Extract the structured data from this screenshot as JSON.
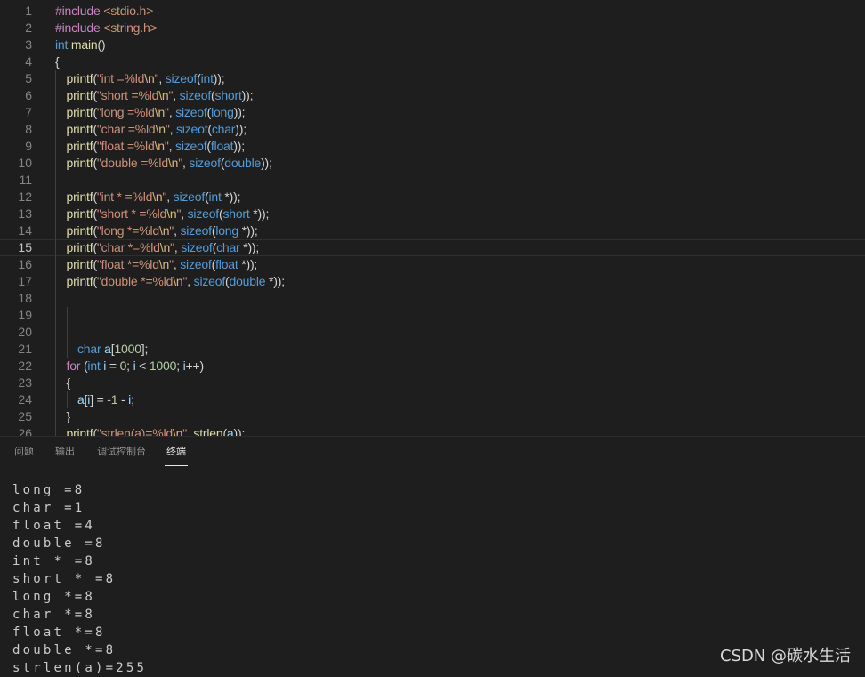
{
  "editor": {
    "active_line": 15,
    "lines": [
      {
        "n": "1",
        "tokens": [
          [
            "#include ",
            "kw"
          ],
          [
            "<stdio.h>",
            "str"
          ]
        ]
      },
      {
        "n": "2",
        "tokens": [
          [
            "#include ",
            "kw"
          ],
          [
            "<string.h>",
            "str"
          ]
        ]
      },
      {
        "n": "3",
        "tokens": [
          [
            "int",
            "type"
          ],
          [
            " ",
            "p"
          ],
          [
            "main",
            "fn"
          ],
          [
            "()",
            "p"
          ]
        ]
      },
      {
        "n": "4",
        "tokens": [
          [
            "{",
            "p"
          ]
        ]
      },
      {
        "n": "5",
        "indent": 1,
        "tokens": [
          [
            "printf",
            "fn"
          ],
          [
            "(",
            "p"
          ],
          [
            "\"int =%ld",
            "str"
          ],
          [
            "\\n",
            "esc"
          ],
          [
            "\"",
            "str"
          ],
          [
            ", ",
            "p"
          ],
          [
            "sizeof",
            "type"
          ],
          [
            "(",
            "p"
          ],
          [
            "int",
            "type"
          ],
          [
            "));",
            "p"
          ]
        ]
      },
      {
        "n": "6",
        "indent": 1,
        "tokens": [
          [
            "printf",
            "fn"
          ],
          [
            "(",
            "p"
          ],
          [
            "\"short =%ld",
            "str"
          ],
          [
            "\\n",
            "esc"
          ],
          [
            "\"",
            "str"
          ],
          [
            ", ",
            "p"
          ],
          [
            "sizeof",
            "type"
          ],
          [
            "(",
            "p"
          ],
          [
            "short",
            "type"
          ],
          [
            "));",
            "p"
          ]
        ]
      },
      {
        "n": "7",
        "indent": 1,
        "tokens": [
          [
            "printf",
            "fn"
          ],
          [
            "(",
            "p"
          ],
          [
            "\"long =%ld",
            "str"
          ],
          [
            "\\n",
            "esc"
          ],
          [
            "\"",
            "str"
          ],
          [
            ", ",
            "p"
          ],
          [
            "sizeof",
            "type"
          ],
          [
            "(",
            "p"
          ],
          [
            "long",
            "type"
          ],
          [
            "));",
            "p"
          ]
        ]
      },
      {
        "n": "8",
        "indent": 1,
        "tokens": [
          [
            "printf",
            "fn"
          ],
          [
            "(",
            "p"
          ],
          [
            "\"char =%ld",
            "str"
          ],
          [
            "\\n",
            "esc"
          ],
          [
            "\"",
            "str"
          ],
          [
            ", ",
            "p"
          ],
          [
            "sizeof",
            "type"
          ],
          [
            "(",
            "p"
          ],
          [
            "char",
            "type"
          ],
          [
            "));",
            "p"
          ]
        ]
      },
      {
        "n": "9",
        "indent": 1,
        "tokens": [
          [
            "printf",
            "fn"
          ],
          [
            "(",
            "p"
          ],
          [
            "\"float =%ld",
            "str"
          ],
          [
            "\\n",
            "esc"
          ],
          [
            "\"",
            "str"
          ],
          [
            ", ",
            "p"
          ],
          [
            "sizeof",
            "type"
          ],
          [
            "(",
            "p"
          ],
          [
            "float",
            "type"
          ],
          [
            "));",
            "p"
          ]
        ]
      },
      {
        "n": "10",
        "indent": 1,
        "tokens": [
          [
            "printf",
            "fn"
          ],
          [
            "(",
            "p"
          ],
          [
            "\"double =%ld",
            "str"
          ],
          [
            "\\n",
            "esc"
          ],
          [
            "\"",
            "str"
          ],
          [
            ", ",
            "p"
          ],
          [
            "sizeof",
            "type"
          ],
          [
            "(",
            "p"
          ],
          [
            "double",
            "type"
          ],
          [
            "));",
            "p"
          ]
        ]
      },
      {
        "n": "11",
        "indent": 1,
        "tokens": []
      },
      {
        "n": "12",
        "indent": 1,
        "tokens": [
          [
            "printf",
            "fn"
          ],
          [
            "(",
            "p"
          ],
          [
            "\"int * =%ld",
            "str"
          ],
          [
            "\\n",
            "esc"
          ],
          [
            "\"",
            "str"
          ],
          [
            ", ",
            "p"
          ],
          [
            "sizeof",
            "type"
          ],
          [
            "(",
            "p"
          ],
          [
            "int",
            "type"
          ],
          [
            " *));",
            "p"
          ]
        ]
      },
      {
        "n": "13",
        "indent": 1,
        "tokens": [
          [
            "printf",
            "fn"
          ],
          [
            "(",
            "p"
          ],
          [
            "\"short * =%ld",
            "str"
          ],
          [
            "\\n",
            "esc"
          ],
          [
            "\"",
            "str"
          ],
          [
            ", ",
            "p"
          ],
          [
            "sizeof",
            "type"
          ],
          [
            "(",
            "p"
          ],
          [
            "short",
            "type"
          ],
          [
            " *));",
            "p"
          ]
        ]
      },
      {
        "n": "14",
        "indent": 1,
        "tokens": [
          [
            "printf",
            "fn"
          ],
          [
            "(",
            "p"
          ],
          [
            "\"long *=%ld",
            "str"
          ],
          [
            "\\n",
            "esc"
          ],
          [
            "\"",
            "str"
          ],
          [
            ", ",
            "p"
          ],
          [
            "sizeof",
            "type"
          ],
          [
            "(",
            "p"
          ],
          [
            "long",
            "type"
          ],
          [
            " *));",
            "p"
          ]
        ]
      },
      {
        "n": "15",
        "indent": 1,
        "tokens": [
          [
            "printf",
            "fn"
          ],
          [
            "(",
            "p"
          ],
          [
            "\"char *=%ld",
            "str"
          ],
          [
            "\\n",
            "esc"
          ],
          [
            "\"",
            "str"
          ],
          [
            ", ",
            "p"
          ],
          [
            "sizeof",
            "type"
          ],
          [
            "(",
            "p"
          ],
          [
            "char",
            "type"
          ],
          [
            " *));",
            "p"
          ]
        ]
      },
      {
        "n": "16",
        "indent": 1,
        "tokens": [
          [
            "printf",
            "fn"
          ],
          [
            "(",
            "p"
          ],
          [
            "\"float *=%ld",
            "str"
          ],
          [
            "\\n",
            "esc"
          ],
          [
            "\"",
            "str"
          ],
          [
            ", ",
            "p"
          ],
          [
            "sizeof",
            "type"
          ],
          [
            "(",
            "p"
          ],
          [
            "float",
            "type"
          ],
          [
            " *));",
            "p"
          ]
        ]
      },
      {
        "n": "17",
        "indent": 1,
        "tokens": [
          [
            "printf",
            "fn"
          ],
          [
            "(",
            "p"
          ],
          [
            "\"double *=%ld",
            "str"
          ],
          [
            "\\n",
            "esc"
          ],
          [
            "\"",
            "str"
          ],
          [
            ", ",
            "p"
          ],
          [
            "sizeof",
            "type"
          ],
          [
            "(",
            "p"
          ],
          [
            "double",
            "type"
          ],
          [
            " *));",
            "p"
          ]
        ]
      },
      {
        "n": "18",
        "indent": 1,
        "tokens": []
      },
      {
        "n": "19",
        "indent": 2,
        "tokens": []
      },
      {
        "n": "20",
        "indent": 2,
        "tokens": []
      },
      {
        "n": "21",
        "indent": 2,
        "tokens": [
          [
            "char",
            "type"
          ],
          [
            " ",
            "p"
          ],
          [
            "a",
            "var"
          ],
          [
            "[",
            "p"
          ],
          [
            "1000",
            "num"
          ],
          [
            "];",
            "p"
          ]
        ]
      },
      {
        "n": "22",
        "indent": 1,
        "tokens": [
          [
            "for",
            "kw"
          ],
          [
            " (",
            "p"
          ],
          [
            "int",
            "type"
          ],
          [
            " ",
            "p"
          ],
          [
            "i",
            "var"
          ],
          [
            " = ",
            "p"
          ],
          [
            "0",
            "num"
          ],
          [
            "; ",
            "p"
          ],
          [
            "i",
            "var"
          ],
          [
            " < ",
            "p"
          ],
          [
            "1000",
            "num"
          ],
          [
            "; ",
            "p"
          ],
          [
            "i",
            "var"
          ],
          [
            "++)",
            "p"
          ]
        ]
      },
      {
        "n": "23",
        "indent": 1,
        "tokens": [
          [
            "{",
            "p"
          ]
        ]
      },
      {
        "n": "24",
        "indent": 2,
        "tokens": [
          [
            "a",
            "var"
          ],
          [
            "[",
            "p"
          ],
          [
            "i",
            "var"
          ],
          [
            "] = ",
            "p"
          ],
          [
            "-1",
            "num"
          ],
          [
            " - ",
            "p"
          ],
          [
            "i",
            "var"
          ],
          [
            ";",
            "p"
          ]
        ]
      },
      {
        "n": "25",
        "indent": 1,
        "tokens": [
          [
            "}",
            "p"
          ]
        ]
      },
      {
        "n": "26",
        "indent": 1,
        "tokens": [
          [
            "printf",
            "fn"
          ],
          [
            "(",
            "p"
          ],
          [
            "\"strlen(a)=%ld",
            "str"
          ],
          [
            "\\n",
            "esc"
          ],
          [
            "\"",
            "str"
          ],
          [
            ", ",
            "p"
          ],
          [
            "strlen",
            "fn"
          ],
          [
            "(",
            "p"
          ],
          [
            "a",
            "var"
          ],
          [
            "));",
            "p"
          ]
        ]
      }
    ]
  },
  "panel": {
    "tabs": [
      {
        "label": "问题",
        "active": false
      },
      {
        "label": "输出",
        "active": false
      },
      {
        "label": "调试控制台",
        "active": false
      },
      {
        "label": "终端",
        "active": true
      }
    ],
    "terminal_lines": [
      "long =8",
      "char =1",
      "float =4",
      "double =8",
      "int * =8",
      "short * =8",
      "long *=8",
      "char *=8",
      "float *=8",
      "double *=8",
      "strlen(a)=255"
    ]
  },
  "watermark": "CSDN @碳水生活"
}
